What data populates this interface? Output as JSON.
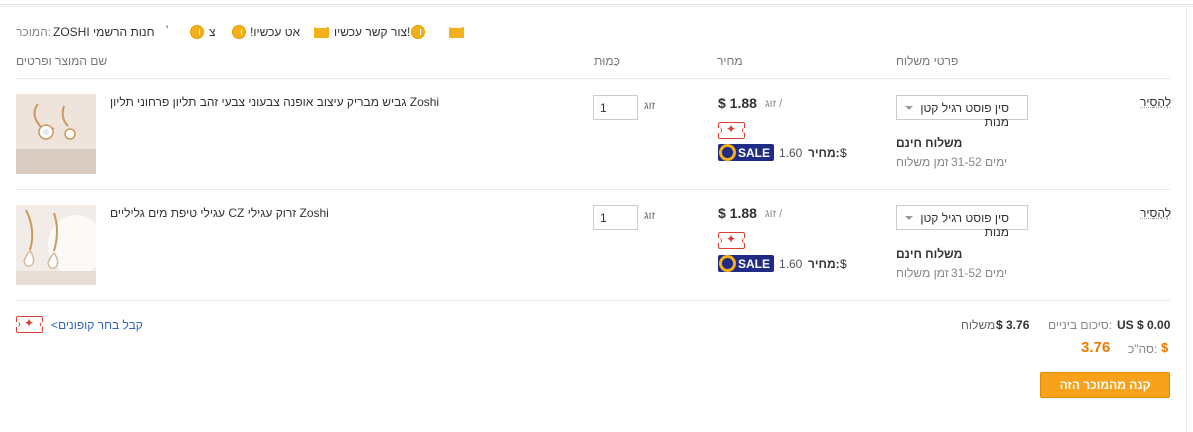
{
  "store": {
    "label": "המוכר:",
    "name": "ZOSHI חנות הרשמי",
    "tick": "'",
    "badge_1_text": "צ",
    "badge_2_text": "!אט עכשיו",
    "contact_now": "צור קשר עכשיו!",
    "icons": [
      "mail-icon",
      "medal-icon"
    ]
  },
  "columns": {
    "product": "שם המוצר ופרטים",
    "quantity": "כַּמוּת",
    "price": "מחיר",
    "shipping": "פרטי משלוח"
  },
  "items": [
    {
      "title": "גביש מבריק עיצוב אופנה צבעוני צבעי זהב תליון פרחוני תליון Zoshi",
      "quantity": "1",
      "unit_label": "זוג",
      "price": "$ 1.88",
      "price_unit": "זוג /",
      "sale_price": "1.60",
      "sale_label": "מחיר:",
      "sale_currency": "$",
      "sale_badge": "SALE",
      "shipping_method": "סין פוסט רגיל קטן מנות",
      "shipping_cost": "משלוח חינם",
      "delivery_time": "ימים 31-52",
      "delivery_label": "זמן משלוח",
      "remove": "לְהָסִיר"
    },
    {
      "title": "עגילי טיפת מים גליליים CZ זרוק עגילי Zoshi",
      "quantity": "1",
      "unit_label": "זוג",
      "price": "$ 1.88",
      "price_unit": "זוג /",
      "sale_price": "1.60",
      "sale_label": "מחיר:",
      "sale_currency": "$",
      "sale_badge": "SALE",
      "shipping_method": "סין פוסט רגיל קטן מנות",
      "shipping_cost": "משלוח חינם",
      "delivery_time": "ימים 31-52",
      "delivery_label": "זמן משלוח",
      "remove": "לְהָסִיר"
    }
  ],
  "coupons": {
    "link": "<קבל בחר קופונים"
  },
  "summary": {
    "subtotal_label": "סיכום ביניים:",
    "subtotal_value": "US $ 0.00",
    "shipping_value": "$ 3.76",
    "shipping_label": "משלוח",
    "total_label": "סה\"כ:",
    "total_value": "3.76",
    "total_currency": "$"
  },
  "buy_button": "קנה מהמוכר הזה",
  "colors": {
    "accent_orange": "#f7a21a",
    "link_blue": "#2e67b1",
    "sale_navy": "#1f2b85",
    "coupon_red": "#d7402e"
  }
}
